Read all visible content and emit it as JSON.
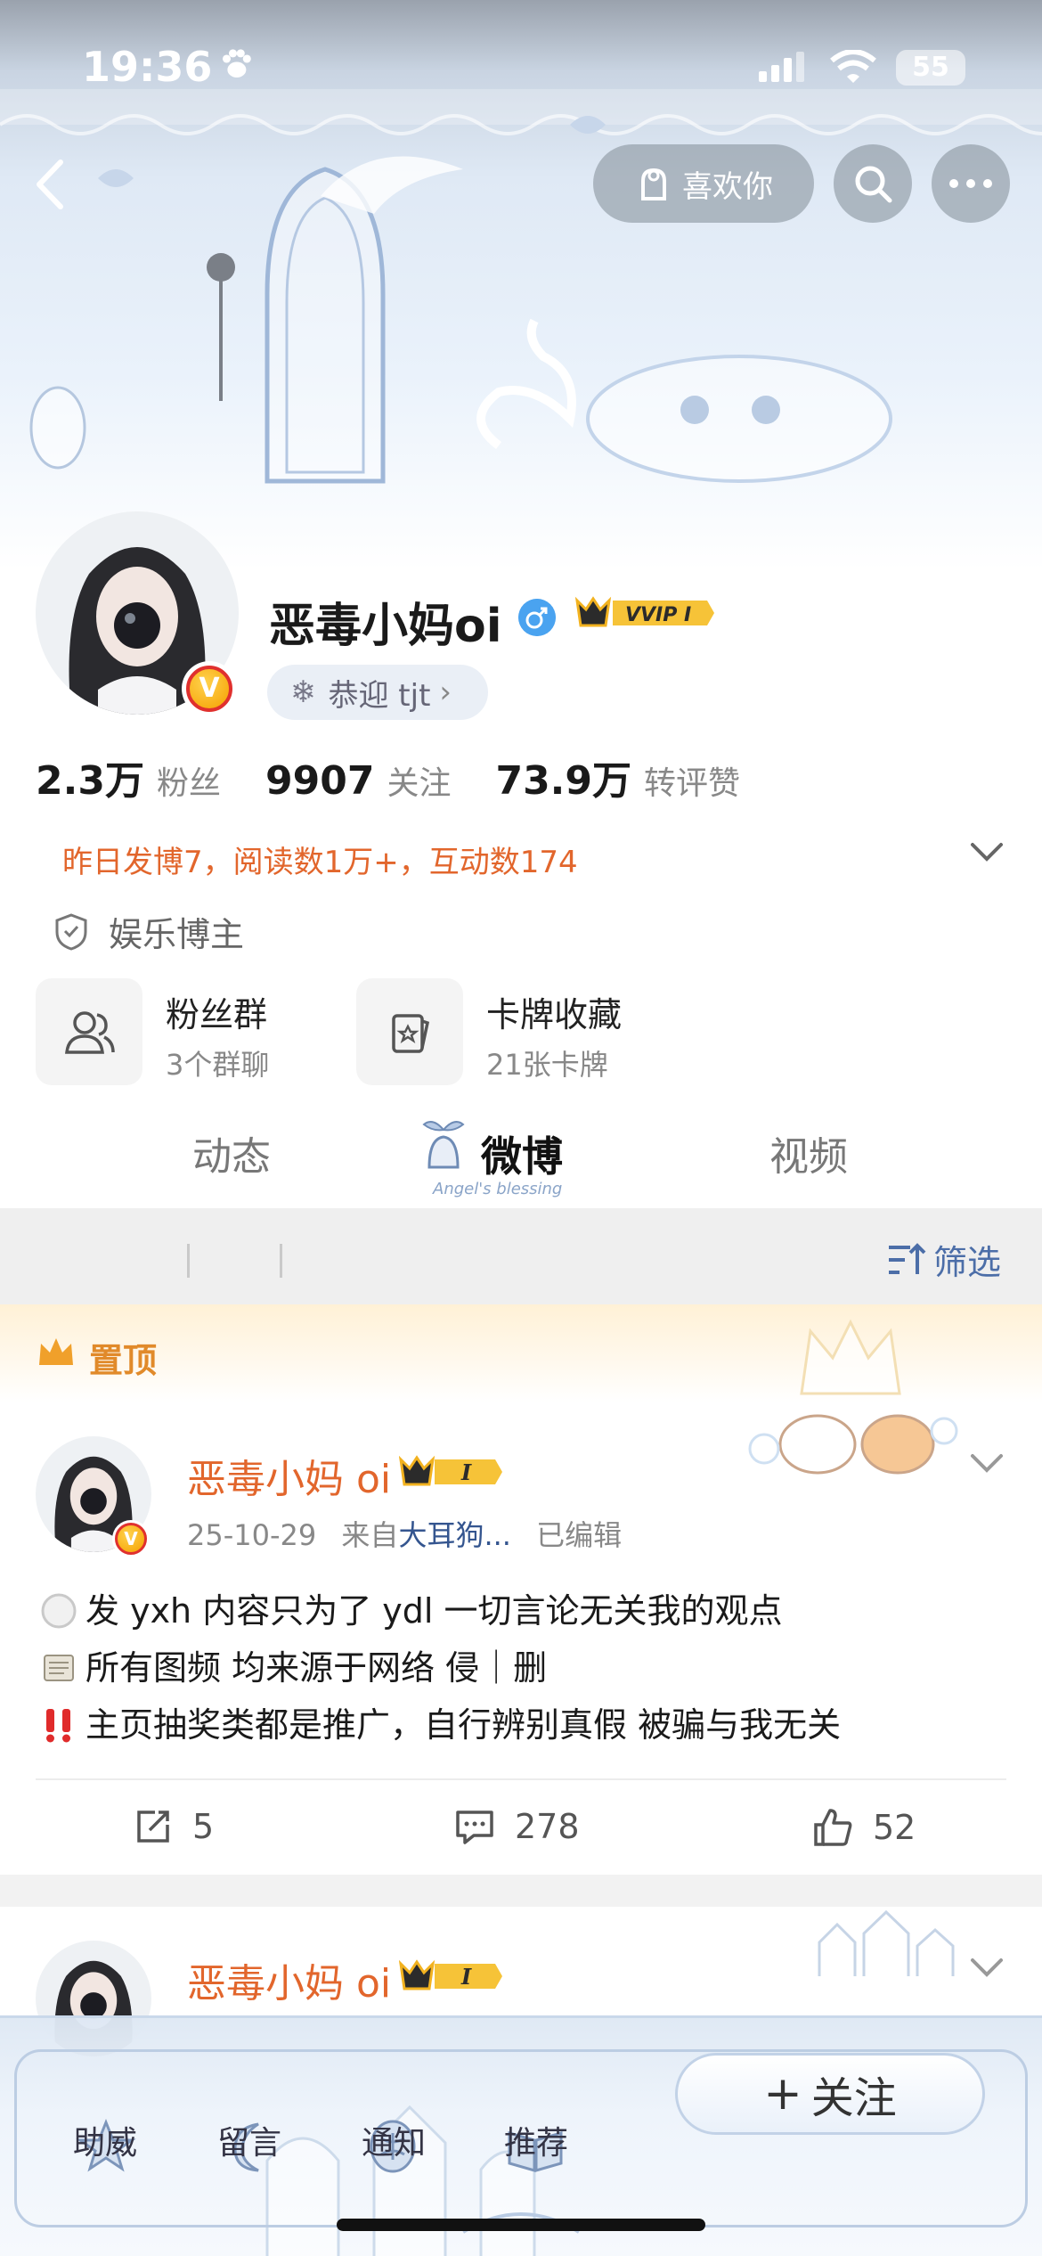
{
  "status_bar": {
    "time": "19:36",
    "battery": "55"
  },
  "top_actions": {
    "like_label": "喜欢你",
    "icons": [
      "back-arrow-icon",
      "heart-hand-icon",
      "search-icon",
      "more-icon"
    ]
  },
  "profile": {
    "name": "恶毒小妈oi",
    "gender": "male",
    "vip_label": "VVIP I",
    "welcome": "恭迎 tjt",
    "stats": [
      {
        "value": "2.3万",
        "label": "粉丝"
      },
      {
        "value": "9907",
        "label": "关注"
      },
      {
        "value": "73.9万",
        "label": "转评赞"
      }
    ],
    "activity": "昨日发博7，阅读数1万+，互动数174",
    "tag": "娱乐博主",
    "tiles": [
      {
        "title": "粉丝群",
        "sub": "3个群聊"
      },
      {
        "title": "卡牌收藏",
        "sub": "21张卡牌"
      }
    ]
  },
  "tabs": {
    "items": [
      "动态",
      "微博",
      "视频"
    ],
    "active": "微博",
    "active_deco_text": "Angel's blessing"
  },
  "filter": {
    "label": "筛选"
  },
  "pinned": {
    "label": "置顶",
    "post": {
      "author": "恶毒小妈 oi",
      "vip_level": "I",
      "date": "25-10-29",
      "from_prefix": "来自",
      "source": "大耳狗...",
      "edited": "已编辑",
      "lines": [
        "发 yxh 内容只为了 ydl 一切言论无关我的观点",
        "所有图频 均来源于网络 侵｜删",
        "主页抽奖类都是推广，自行辨别真假 被骗与我无关"
      ],
      "reposts": "5",
      "comments": "278",
      "likes": "52"
    }
  },
  "second_post": {
    "author": "恶毒小妈 oi",
    "vip_level": "I"
  },
  "bottom_bar": {
    "items": [
      "助威",
      "留言",
      "通知",
      "推荐"
    ],
    "follow_label": "关注"
  },
  "colors": {
    "accent_orange": "#e2662c",
    "link_blue": "#34558f",
    "pinned_gold": "#e18a2a"
  }
}
